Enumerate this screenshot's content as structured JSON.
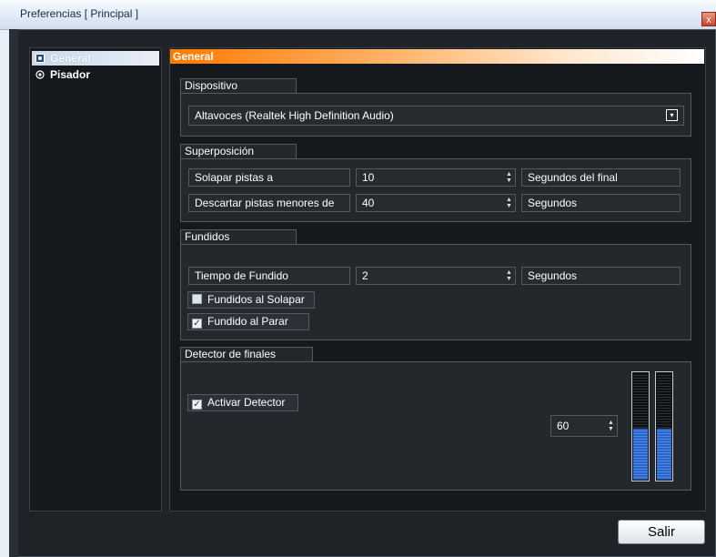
{
  "window": {
    "title": "Preferencias [ Principal ]",
    "close_glyph": "x"
  },
  "nav": {
    "items": [
      {
        "label": "General",
        "icon": "radio-icon",
        "selected": true
      },
      {
        "label": "Pisador",
        "icon": "radio-icon",
        "selected": false
      }
    ]
  },
  "panel": {
    "title": "General"
  },
  "dispositivo": {
    "label": "Dispositivo",
    "selected": "Altavoces (Realtek High Definition Audio)",
    "arrow": "▾"
  },
  "superposicion": {
    "label": "Superposición",
    "rows": [
      {
        "label": "Solapar pistas a",
        "value": "10",
        "unit": "Segundos del final"
      },
      {
        "label": "Descartar pistas menores de",
        "value": "40",
        "unit": "Segundos"
      }
    ]
  },
  "fundidos": {
    "label": "Fundidos",
    "row": {
      "label": "Tiempo de Fundido",
      "value": "2",
      "unit": "Segundos"
    },
    "checks": [
      {
        "label": "Fundidos al Solapar",
        "checked": false
      },
      {
        "label": "Fundido al Parar",
        "checked": true
      }
    ]
  },
  "detector": {
    "label": "Detector de finales",
    "check": {
      "label": "Activar Detector",
      "checked": true
    },
    "value": "60",
    "meter_levels": [
      0.48,
      0.48
    ]
  },
  "footer": {
    "exit_label": "Salir"
  },
  "check_glyph": "✓",
  "spin_up": "▲",
  "spin_down": "▼"
}
